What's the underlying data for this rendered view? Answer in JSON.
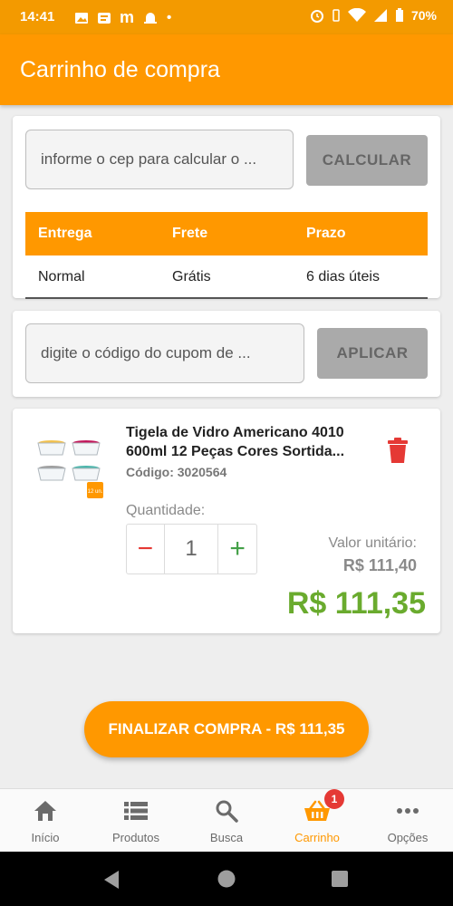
{
  "status_bar": {
    "time": "14:41",
    "battery": "70%"
  },
  "app_bar": {
    "title": "Carrinho de compra"
  },
  "shipping": {
    "cep_placeholder": "informe o cep para calcular o ...",
    "calculate_label": "CALCULAR",
    "table": {
      "headers": [
        "Entrega",
        "Frete",
        "Prazo"
      ],
      "row": [
        "Normal",
        "Grátis",
        "6 dias úteis"
      ]
    }
  },
  "coupon": {
    "placeholder": "digite o código do cupom de ...",
    "apply_label": "APLICAR"
  },
  "product": {
    "title": "Tigela de Vidro Americano 4010 600ml 12 Peças Cores Sortida...",
    "code": "Código: 3020564",
    "quantity_label": "Quantidade:",
    "quantity": "1",
    "minus": "−",
    "plus": "+",
    "unit_label": "Valor unitário:",
    "unit_price": "R$ 111,40",
    "total_price": "R$ 111,35",
    "thumb_tag": "12 un."
  },
  "finalize_label": "FINALIZAR COMPRA - R$ 111,35",
  "bottom_nav": {
    "items": [
      {
        "label": "Início",
        "icon": "home-icon"
      },
      {
        "label": "Produtos",
        "icon": "list-icon"
      },
      {
        "label": "Busca",
        "icon": "search-icon"
      },
      {
        "label": "Carrinho",
        "icon": "cart-icon",
        "badge": "1",
        "active": true
      },
      {
        "label": "Opções",
        "icon": "more-icon"
      }
    ]
  },
  "colors": {
    "primary": "#ff9800",
    "price_green": "#6aab2e",
    "danger": "#e53935",
    "plus_green": "#43a047"
  }
}
